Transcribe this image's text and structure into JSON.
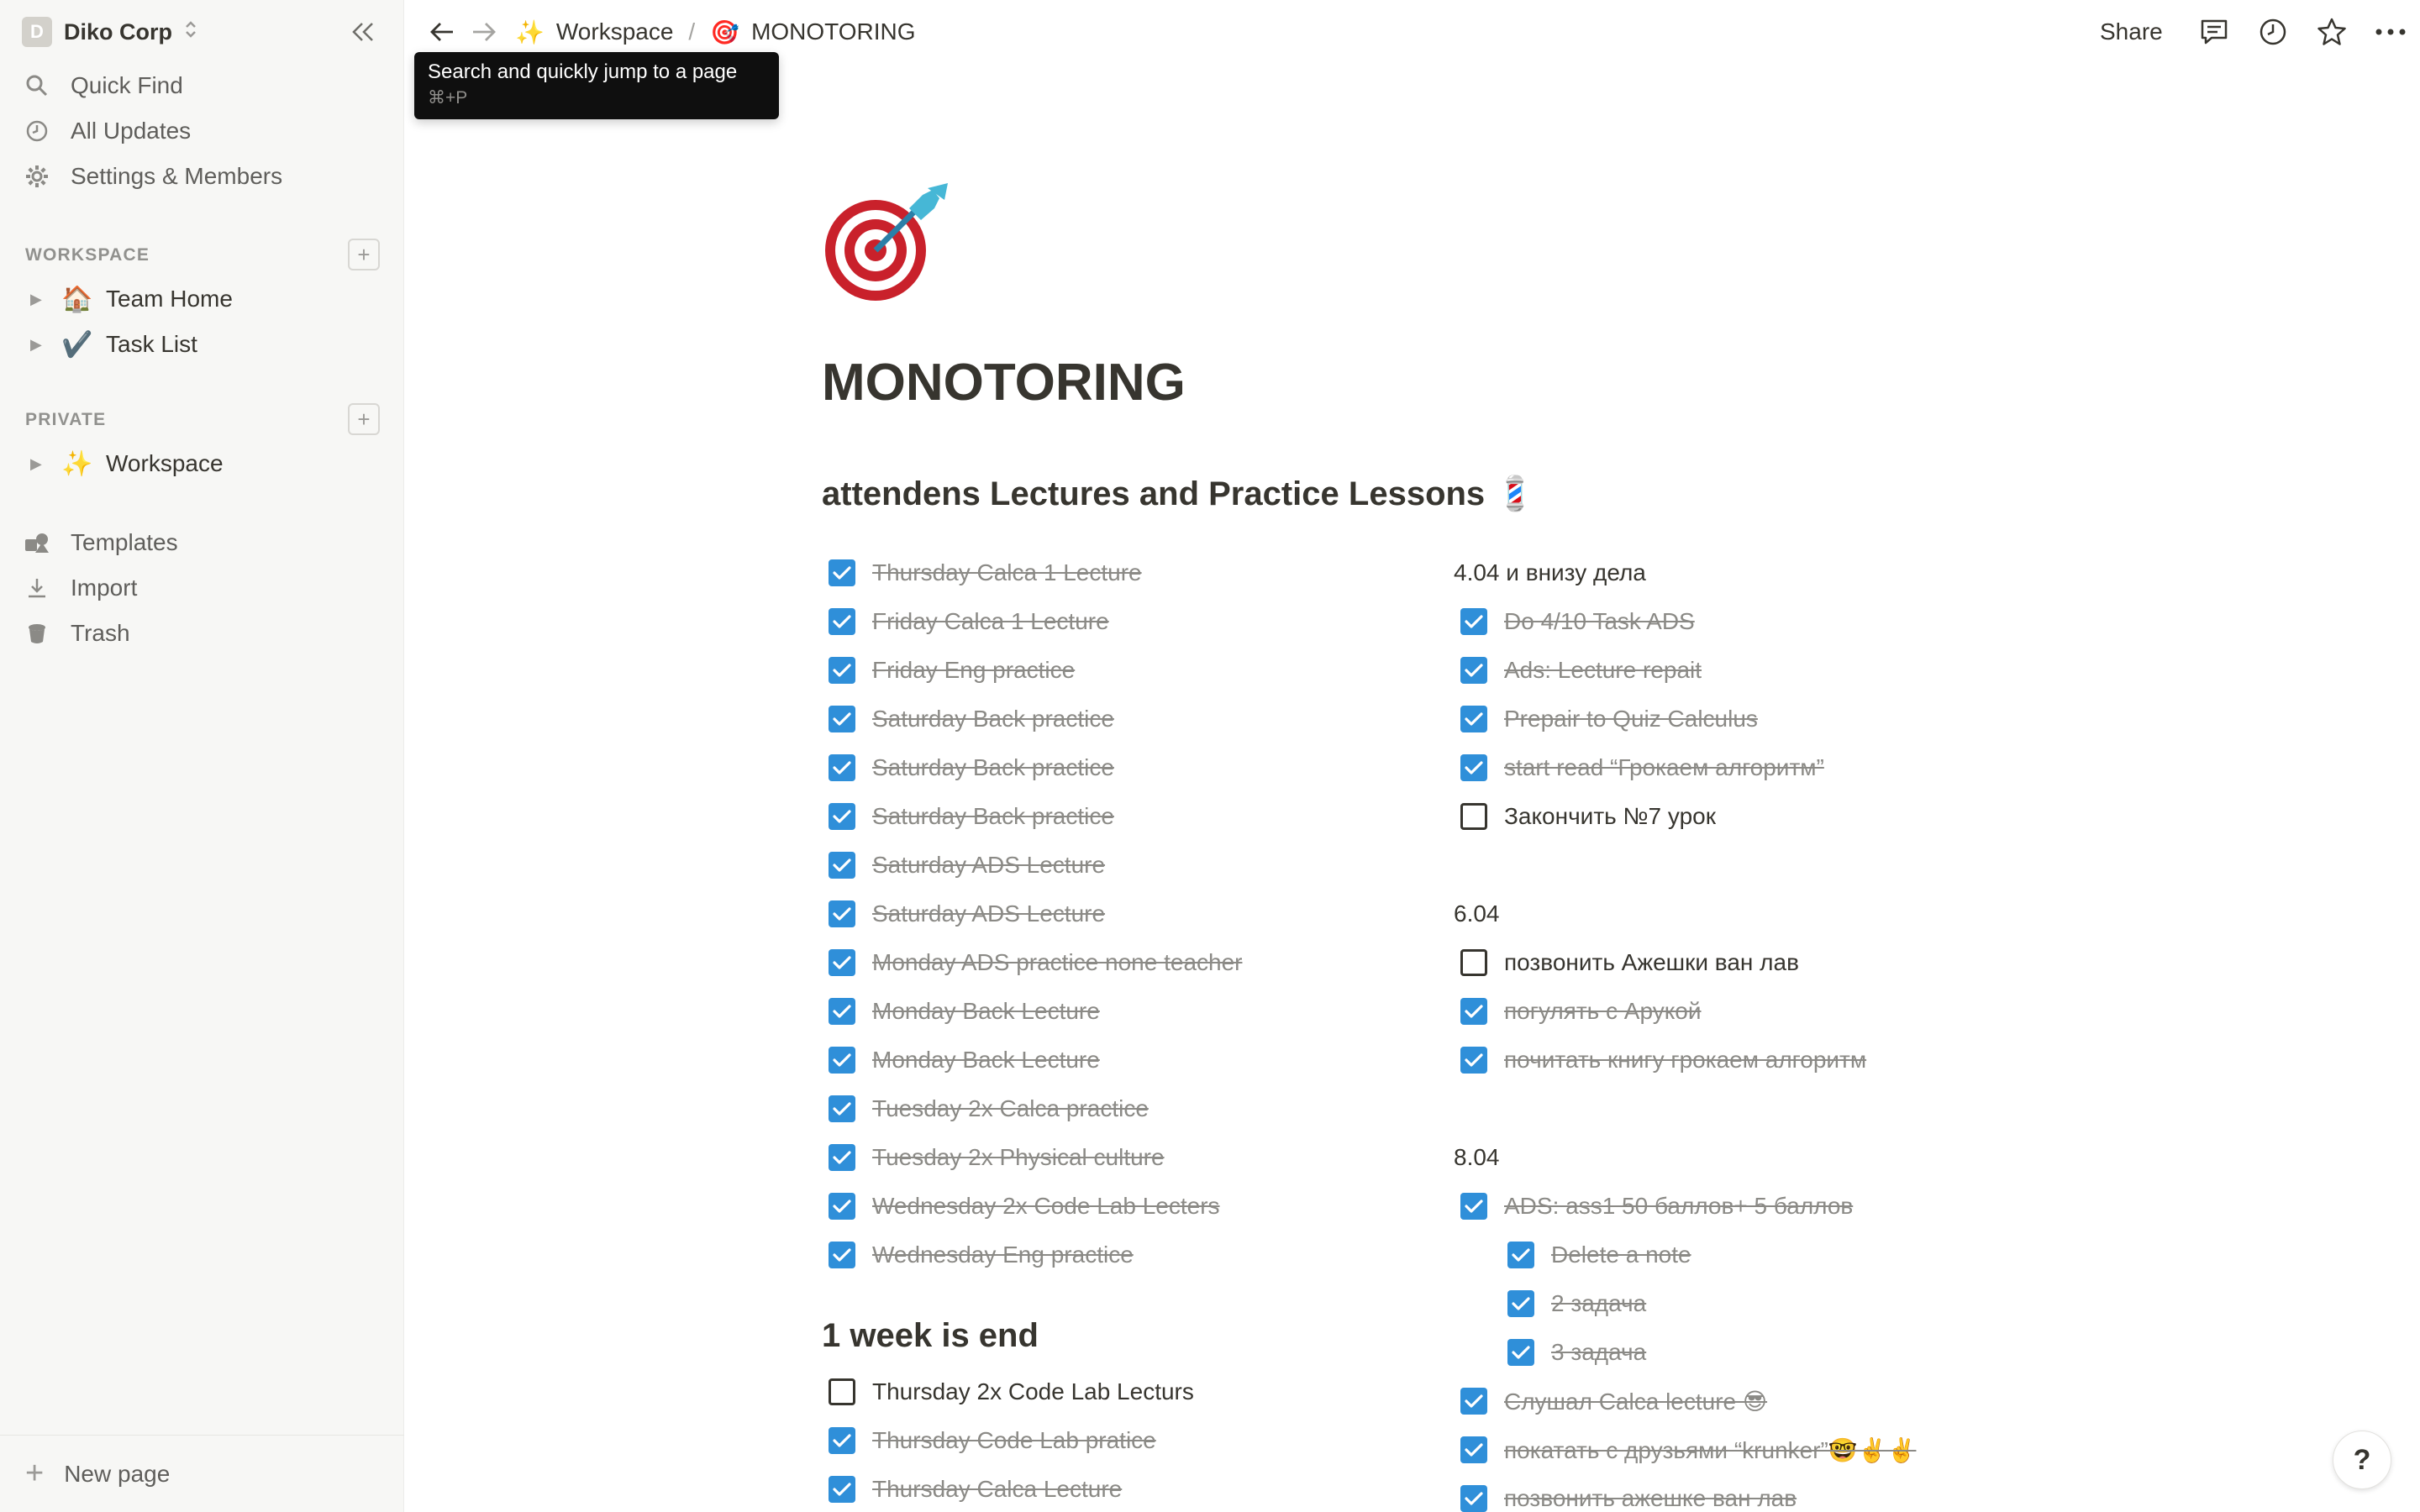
{
  "sidebar": {
    "workspace_initial": "D",
    "workspace_name": "Diko Corp",
    "nav": [
      {
        "label": "Quick Find",
        "icon": "search-icon"
      },
      {
        "label": "All Updates",
        "icon": "clock-icon"
      },
      {
        "label": "Settings & Members",
        "icon": "gear-icon"
      }
    ],
    "workspace_section": "WORKSPACE",
    "workspace_pages": [
      {
        "emoji": "🏠",
        "label": "Team Home"
      },
      {
        "emoji": "✔️",
        "label": "Task List"
      }
    ],
    "private_section": "PRIVATE",
    "private_pages": [
      {
        "emoji": "✨",
        "label": "Workspace"
      }
    ],
    "utilities": [
      {
        "label": "Templates",
        "icon": "templates-icon"
      },
      {
        "label": "Import",
        "icon": "download-icon"
      },
      {
        "label": "Trash",
        "icon": "trash-icon"
      }
    ],
    "new_page": "New page"
  },
  "topbar": {
    "crumb1_emoji": "✨",
    "crumb1": "Workspace",
    "crumb_sep": "/",
    "crumb2_emoji": "🎯",
    "crumb2": "MONOTORING",
    "share": "Share"
  },
  "tooltip": {
    "title": "Search and quickly jump to a page",
    "shortcut": "⌘+P"
  },
  "page": {
    "icon": "🎯",
    "title": "MONOTORING",
    "heading1": "attendens Lectures and Practice Lessons 💈",
    "left_todos": [
      {
        "text": "Thursday Calca 1 Lecture",
        "done": true
      },
      {
        "text": "Friday Calca 1 Lecture",
        "done": true
      },
      {
        "text": "Friday Eng practice",
        "done": true
      },
      {
        "text": "Saturday Back practice",
        "done": true
      },
      {
        "text": "Saturday Back practice",
        "done": true
      },
      {
        "text": "Saturday Back practice",
        "done": true
      },
      {
        "text": "Saturday ADS Lecture",
        "done": true
      },
      {
        "text": "Saturday ADS Lecture",
        "done": true
      },
      {
        "text": "Monday ADS practice none teacher",
        "done": true
      },
      {
        "text": "Monday Back Lecture",
        "done": true
      },
      {
        "text": "Monday Back Lecture",
        "done": true
      },
      {
        "text": "Tuesday 2x Calca practice",
        "done": true
      },
      {
        "text": "Tuesday 2x Physical culture",
        "done": true
      },
      {
        "text": "Wednesday 2x Code Lab Lecters",
        "done": true
      },
      {
        "text": "Wednesday Eng practice",
        "done": true
      }
    ],
    "heading2": "1 week is end",
    "left_todos2": [
      {
        "text": "Thursday 2x Code Lab Lecturs",
        "done": false
      },
      {
        "text": "Thursday Code Lab pratice",
        "done": true
      },
      {
        "text": "Thursday Calca Lecture",
        "done": true
      }
    ],
    "date1": "4.04 и внизу дела",
    "right_todos1": [
      {
        "text": "Do 4/10 Task ADS",
        "done": true
      },
      {
        "text": "Ads: Lecture repait",
        "done": true
      },
      {
        "text": "Prepair to Quiz Calculus",
        "done": true
      },
      {
        "text": "start read “Грокаем алгоритм”",
        "done": true
      },
      {
        "text": "Закончить №7 урок",
        "done": false
      }
    ],
    "date2": "6.04",
    "right_todos2": [
      {
        "text": "позвонить Ажешки ван лав",
        "done": false
      },
      {
        "text": "погулять с Арукой",
        "done": true
      },
      {
        "text": "почитать книгу грокаем алгоритм",
        "done": true
      }
    ],
    "date3": "8.04",
    "right_todos3": [
      {
        "text": "ADS:  ass1 50 баллов+ 5 баллов",
        "done": true,
        "indent": 0
      },
      {
        "text": "Delete a note",
        "done": true,
        "indent": 1
      },
      {
        "text": "2 задача",
        "done": true,
        "indent": 1
      },
      {
        "text": "3 задача",
        "done": true,
        "indent": 1
      },
      {
        "text": "Слушал Calca lecture 😎",
        "done": true,
        "indent": 0
      },
      {
        "text": "покатать с друзьями “krunker”🤓✌️✌️",
        "done": true,
        "indent": 0
      },
      {
        "text": "позвонить ажешке ван лав",
        "done": true,
        "indent": 0
      }
    ],
    "help": "?"
  }
}
